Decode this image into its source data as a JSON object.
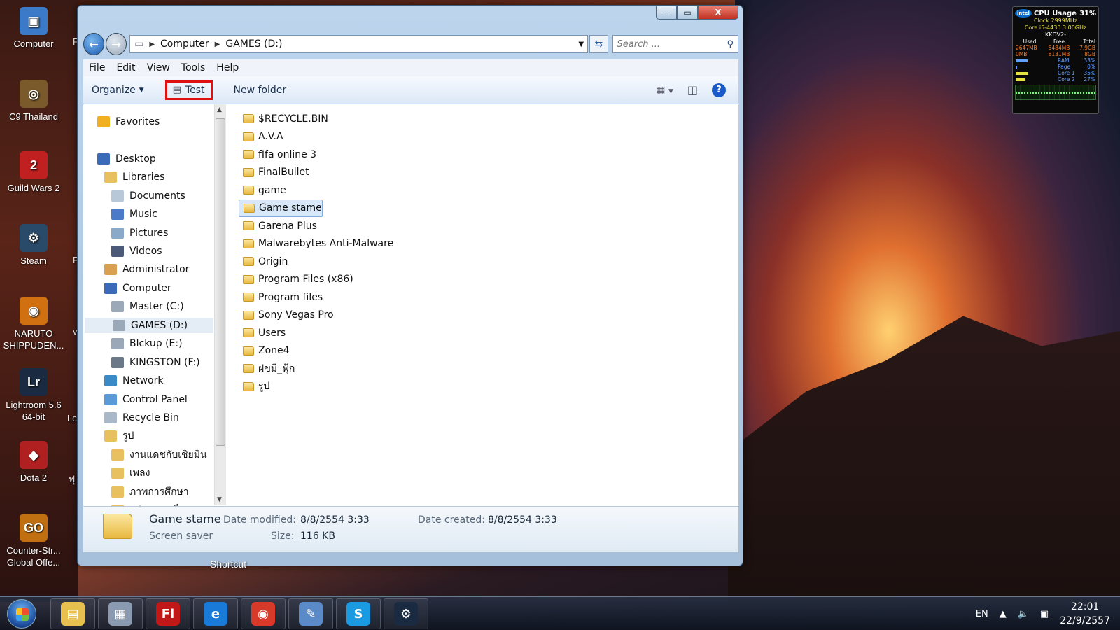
{
  "desktop": {
    "icons": [
      {
        "label": "Computer",
        "icon": "computer-icon",
        "color": "#3a7ac8",
        "glyph": "▣"
      },
      {
        "label": "C9 Thailand",
        "icon": "c9-icon",
        "color": "#7a5a2a",
        "glyph": "◎"
      },
      {
        "label": "Guild Wars 2",
        "icon": "guild-wars-icon",
        "color": "#c02020",
        "glyph": "2"
      },
      {
        "label": "Steam",
        "icon": "steam-icon",
        "color": "#2a4a6a",
        "glyph": "⚙"
      },
      {
        "label": "NARUTO SHIPPUDEN...",
        "icon": "naruto-icon",
        "color": "#d07010",
        "glyph": "◉"
      },
      {
        "label": "Lightroom 5.6 64-bit",
        "icon": "lightroom-icon",
        "color": "#1a2a40",
        "glyph": "Lr"
      },
      {
        "label": "Dota 2",
        "icon": "dota-icon",
        "color": "#b02020",
        "glyph": "◆"
      },
      {
        "label": "Counter-Str... Global Offe...",
        "icon": "csgo-icon",
        "color": "#c07010",
        "glyph": "GO"
      }
    ],
    "cut_labels": [
      "F",
      "F",
      "Lc",
      "ฟุ",
      "v"
    ],
    "shortcut_label": "Shortcut"
  },
  "gadget": {
    "title": "CPU Usage",
    "usage": "31%",
    "clock": "Clock:2999MHz",
    "model": "Core i5-4430 3.00GHz",
    "host": "KKDV2-",
    "headers": [
      "Used",
      "Free",
      "Total"
    ],
    "rows": [
      [
        "2647MB",
        "5484MB",
        "7.9GB"
      ],
      [
        "0MB",
        "8131MB",
        "8GB"
      ]
    ],
    "meters": [
      {
        "name": "RAM",
        "value": "33%",
        "fraction": 0.33
      },
      {
        "name": "Page",
        "value": "0%",
        "fraction": 0.0
      },
      {
        "name": "Core 1",
        "value": "35%",
        "fraction": 0.35
      },
      {
        "name": "Core 2",
        "value": "27%",
        "fraction": 0.27
      }
    ]
  },
  "window": {
    "controls": {
      "minimize": "—",
      "maximize": "▭",
      "close": "X"
    },
    "address": {
      "root_icon": "drive-icon",
      "crumbs": [
        "Computer",
        "GAMES (D:)"
      ]
    },
    "search": {
      "placeholder": "Search ..."
    },
    "menu": [
      "File",
      "Edit",
      "View",
      "Tools",
      "Help"
    ],
    "toolbar": {
      "organize": "Organize",
      "test": "Test",
      "new_folder": "New folder"
    },
    "nav": [
      {
        "label": "Favorites",
        "indent": 0,
        "icon": "star-icon",
        "color": "#f0b020",
        "gap_before": 0
      },
      {
        "label": "Desktop",
        "indent": 0,
        "icon": "desktop-icon",
        "color": "#3a6ab8",
        "gap_before": 1
      },
      {
        "label": "Libraries",
        "indent": 1,
        "icon": "libraries-icon",
        "color": "#e8c060",
        "gap_before": 0
      },
      {
        "label": "Documents",
        "indent": 2,
        "icon": "documents-icon",
        "color": "#b8c8d8",
        "gap_before": 0
      },
      {
        "label": "Music",
        "indent": 2,
        "icon": "music-icon",
        "color": "#4a7ac8",
        "gap_before": 0
      },
      {
        "label": "Pictures",
        "indent": 2,
        "icon": "pictures-icon",
        "color": "#8aa8c8",
        "gap_before": 0
      },
      {
        "label": "Videos",
        "indent": 2,
        "icon": "videos-icon",
        "color": "#4a5a78",
        "gap_before": 0
      },
      {
        "label": "Administrator",
        "indent": 1,
        "icon": "user-icon",
        "color": "#d8a050",
        "gap_before": 0
      },
      {
        "label": "Computer",
        "indent": 1,
        "icon": "computer-icon",
        "color": "#3a6ab8",
        "gap_before": 0
      },
      {
        "label": "Master (C:)",
        "indent": 2,
        "icon": "drive-c-icon",
        "color": "#9aa8b8",
        "gap_before": 0
      },
      {
        "label": "GAMES (D:)",
        "indent": 2,
        "icon": "drive-d-icon",
        "color": "#9aa8b8",
        "gap_before": 0,
        "selected": true
      },
      {
        "label": "Blckup (E:)",
        "indent": 2,
        "icon": "drive-e-icon",
        "color": "#9aa8b8",
        "gap_before": 0
      },
      {
        "label": "KINGSTON (F:)",
        "indent": 2,
        "icon": "usb-drive-icon",
        "color": "#6a7888",
        "gap_before": 0
      },
      {
        "label": "Network",
        "indent": 1,
        "icon": "network-icon",
        "color": "#3a8ac8",
        "gap_before": 0
      },
      {
        "label": "Control Panel",
        "indent": 1,
        "icon": "control-panel-icon",
        "color": "#5a9ad8",
        "gap_before": 0
      },
      {
        "label": "Recycle Bin",
        "indent": 1,
        "icon": "recycle-bin-icon",
        "color": "#a8b8c8",
        "gap_before": 0
      },
      {
        "label": "รูป",
        "indent": 1,
        "icon": "folder-icon",
        "color": "#e8c060",
        "gap_before": 0
      },
      {
        "label": "งานแดชกับเชิยมิน",
        "indent": 2,
        "icon": "folder-icon",
        "color": "#e8c060",
        "gap_before": 0
      },
      {
        "label": "เพลง",
        "indent": 2,
        "icon": "folder-icon",
        "color": "#e8c060",
        "gap_before": 0
      },
      {
        "label": "ภาพการศึกษา",
        "indent": 2,
        "icon": "folder-icon",
        "color": "#e8c060",
        "gap_before": 0
      },
      {
        "label": "รูปของสมเร็ม",
        "indent": 2,
        "icon": "folder-icon",
        "color": "#e8c060",
        "gap_before": 0
      }
    ],
    "files": [
      "$RECYCLE.BIN",
      "A.V.A",
      "fIfa online 3",
      "FinalBullet",
      "game",
      "Game stame",
      "Garena Plus",
      "Malwarebytes Anti-Malware",
      "Origin",
      "Program Files (x86)",
      "Program files",
      "Sony Vegas Pro",
      "Users",
      "Zone4",
      "ฝขมี_ฟุ้ก",
      "รูป"
    ],
    "selected_file": "Game stame",
    "details": {
      "name": "Game stame",
      "type": "Screen saver",
      "modified_label": "Date modified:",
      "modified": "8/8/2554 3:33",
      "created_label": "Date created:",
      "created": "8/8/2554 3:33",
      "size_label": "Size:",
      "size": "116 KB"
    }
  },
  "taskbar": {
    "apps": [
      {
        "name": "explorer",
        "icon": "folder-icon",
        "color": "#e8c050",
        "glyph": "▤"
      },
      {
        "name": "calculator",
        "icon": "calculator-icon",
        "color": "#8a9ab0",
        "glyph": "▦"
      },
      {
        "name": "flash",
        "icon": "flash-icon",
        "color": "#c01818",
        "glyph": "Fl"
      },
      {
        "name": "internet-explorer",
        "icon": "ie-icon",
        "color": "#1a7ad8",
        "glyph": "e"
      },
      {
        "name": "chrome",
        "icon": "chrome-icon",
        "color": "#d83a2a",
        "glyph": "◉"
      },
      {
        "name": "paint",
        "icon": "paint-icon",
        "color": "#5a8ac8",
        "glyph": "✎"
      },
      {
        "name": "skype",
        "icon": "skype-icon",
        "color": "#1a9ae0",
        "glyph": "S"
      },
      {
        "name": "steam",
        "icon": "steam-icon",
        "color": "#1a2a40",
        "glyph": "⚙"
      }
    ],
    "language": "EN",
    "time": "22:01",
    "date": "22/9/2557"
  }
}
